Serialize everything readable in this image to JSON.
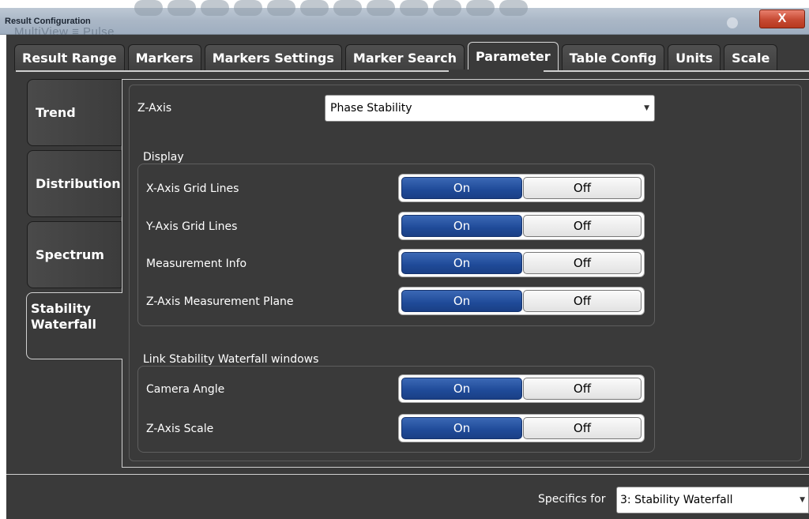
{
  "window": {
    "title": "Result Configuration",
    "background_text": "MultiView  ≡  Pulse",
    "close_label": "X"
  },
  "tabs": [
    {
      "label": "Result Range",
      "active": false
    },
    {
      "label": "Markers",
      "active": false
    },
    {
      "label": "Markers Settings",
      "active": false
    },
    {
      "label": "Marker Search",
      "active": false
    },
    {
      "label": "Parameter",
      "active": true
    },
    {
      "label": "Table Config",
      "active": false
    },
    {
      "label": "Units",
      "active": false
    },
    {
      "label": "Scale",
      "active": false
    }
  ],
  "side_tabs": [
    {
      "label": "Trend",
      "active": false
    },
    {
      "label": "Distribution",
      "active": false
    },
    {
      "label": "Spectrum",
      "active": false
    },
    {
      "label": "Stability Waterfall",
      "active": true
    }
  ],
  "z_axis": {
    "label": "Z-Axis",
    "value": "Phase Stability"
  },
  "display": {
    "title": "Display",
    "rows": [
      {
        "label": "X-Axis Grid Lines",
        "on": "On",
        "off": "Off",
        "state": "On"
      },
      {
        "label": "Y-Axis Grid Lines",
        "on": "On",
        "off": "Off",
        "state": "On"
      },
      {
        "label": "Measurement Info",
        "on": "On",
        "off": "Off",
        "state": "On"
      },
      {
        "label": "Z-Axis Measurement Plane",
        "on": "On",
        "off": "Off",
        "state": "On"
      }
    ]
  },
  "link": {
    "title": "Link Stability Waterfall windows",
    "rows": [
      {
        "label": "Camera Angle",
        "on": "On",
        "off": "Off",
        "state": "On"
      },
      {
        "label": "Z-Axis Scale",
        "on": "On",
        "off": "Off",
        "state": "On"
      }
    ]
  },
  "footer": {
    "specifics_label": "Specifics for",
    "specifics_value": "3: Stability Waterfall"
  },
  "colors": {
    "toggle_on": "#1f4a98",
    "panel_bg": "#3a3a3a",
    "close_button": "#c64a33"
  }
}
